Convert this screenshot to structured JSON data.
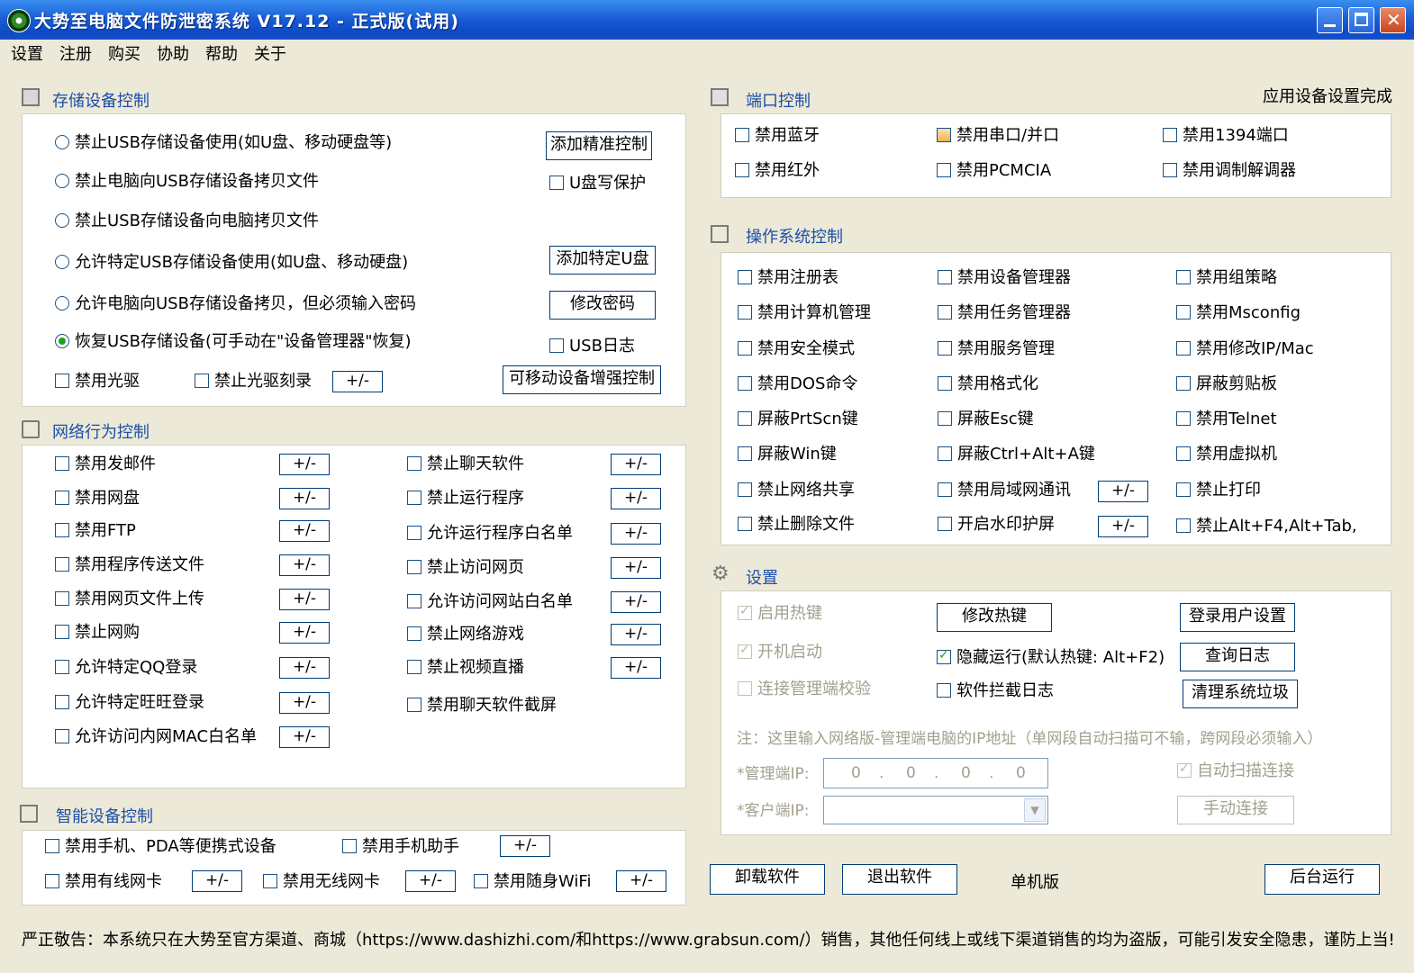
{
  "window": {
    "title": "大势至电脑文件防泄密系统 V17.12 - 正式版(试用)"
  },
  "menu": [
    "设置",
    "注册",
    "购买",
    "协助",
    "帮助",
    "关于"
  ],
  "storage": {
    "title": "存储设备控制",
    "radios": [
      "禁止USB存储设备使用(如U盘、移动硬盘等)",
      "禁止电脑向USB存储设备拷贝文件",
      "禁止USB存储设备向电脑拷贝文件",
      "允许特定USB存储设备使用(如U盘、移动硬盘)",
      "允许电脑向USB存储设备拷贝，但必须输入密码",
      "恢复USB存储设备(可手动在\"设备管理器\"恢复)"
    ],
    "selected_radio_index": 5,
    "btn_precise": "添加精准控制",
    "cb_write_protect": "U盘写保护",
    "btn_add_udisk": "添加特定U盘",
    "btn_change_pwd": "修改密码",
    "cb_usb_log": "USB日志",
    "cb_disable_cdrom": "禁用光驱",
    "cb_disable_burn": "禁止光驱刻录",
    "pm": "+/-",
    "btn_enhanced": "可移动设备增强控制"
  },
  "network": {
    "title": "网络行为控制",
    "left": [
      "禁用发邮件",
      "禁用网盘",
      "禁用FTP",
      "禁用程序传送文件",
      "禁用网页文件上传",
      "禁止网购",
      "允许特定QQ登录",
      "允许特定旺旺登录",
      "允许访问内网MAC白名单"
    ],
    "right": [
      "禁止聊天软件",
      "禁止运行程序",
      "允许运行程序白名单",
      "禁止访问网页",
      "允许访问网站白名单",
      "禁止网络游戏",
      "禁止视频直播",
      "禁用聊天软件截屏"
    ],
    "pm": "+/-"
  },
  "smart": {
    "title": "智能设备控制",
    "items": [
      "禁用手机、PDA等便携式设备",
      "禁用手机助手",
      "禁用有线网卡",
      "禁用无线网卡",
      "禁用随身WiFi"
    ],
    "pm": "+/-"
  },
  "port": {
    "title": "端口控制",
    "status": "应用设备设置完成",
    "items": [
      "禁用蓝牙",
      "禁用串口/并口",
      "禁用1394端口",
      "禁用红外",
      "禁用PCMCIA",
      "禁用调制解调器"
    ]
  },
  "os": {
    "title": "操作系统控制",
    "col1": [
      "禁用注册表",
      "禁用计算机管理",
      "禁用安全模式",
      "禁用DOS命令",
      "屏蔽PrtScn键",
      "屏蔽Win键",
      "禁止网络共享",
      "禁止删除文件"
    ],
    "col2": [
      "禁用设备管理器",
      "禁用任务管理器",
      "禁用服务管理",
      "禁用格式化",
      "屏蔽Esc键",
      "屏蔽Ctrl+Alt+A键",
      "禁用局域网通讯",
      "开启水印护屏"
    ],
    "col3": [
      "禁用组策略",
      "禁用Msconfig",
      "禁用修改IP/Mac",
      "屏蔽剪贴板",
      "禁用Telnet",
      "禁用虚拟机",
      "禁止打印",
      "禁止Alt+F4,Alt+Tab,"
    ],
    "pm": "+/-"
  },
  "settings": {
    "title": "设置",
    "cb_hotkey": "启用热键",
    "cb_autostart": "开机启动",
    "cb_verify": "连接管理端校验",
    "btn_change_hotkey": "修改热键",
    "cb_hidden": "隐藏运行(默认热键: Alt+F2)",
    "cb_intercept_log": "软件拦截日志",
    "btn_login_settings": "登录用户设置",
    "btn_query_log": "查询日志",
    "btn_clean": "清理系统垃圾",
    "note": "注：这里输入网络版-管理端电脑的IP地址（单网段自动扫描可不输，跨网段必须输入）",
    "admin_ip_label": "*管理端IP:",
    "client_ip_label": "*客户端IP:",
    "ip_value": [
      "0",
      "0",
      "0",
      "0"
    ],
    "cb_auto_scan": "自动扫描连接",
    "btn_manual": "手动连接"
  },
  "bottom": {
    "btn_uninstall": "卸载软件",
    "btn_exit": "退出软件",
    "edition": "单机版",
    "btn_background": "后台运行"
  },
  "warning": "严正敬告：本系统只在大势至官方渠道、商城（https://www.dashizhi.com/和https://www.grabsun.com/）销售，其他任何线上或线下渠道销售的均为盗版，可能引发安全隐患，谨防上当!"
}
